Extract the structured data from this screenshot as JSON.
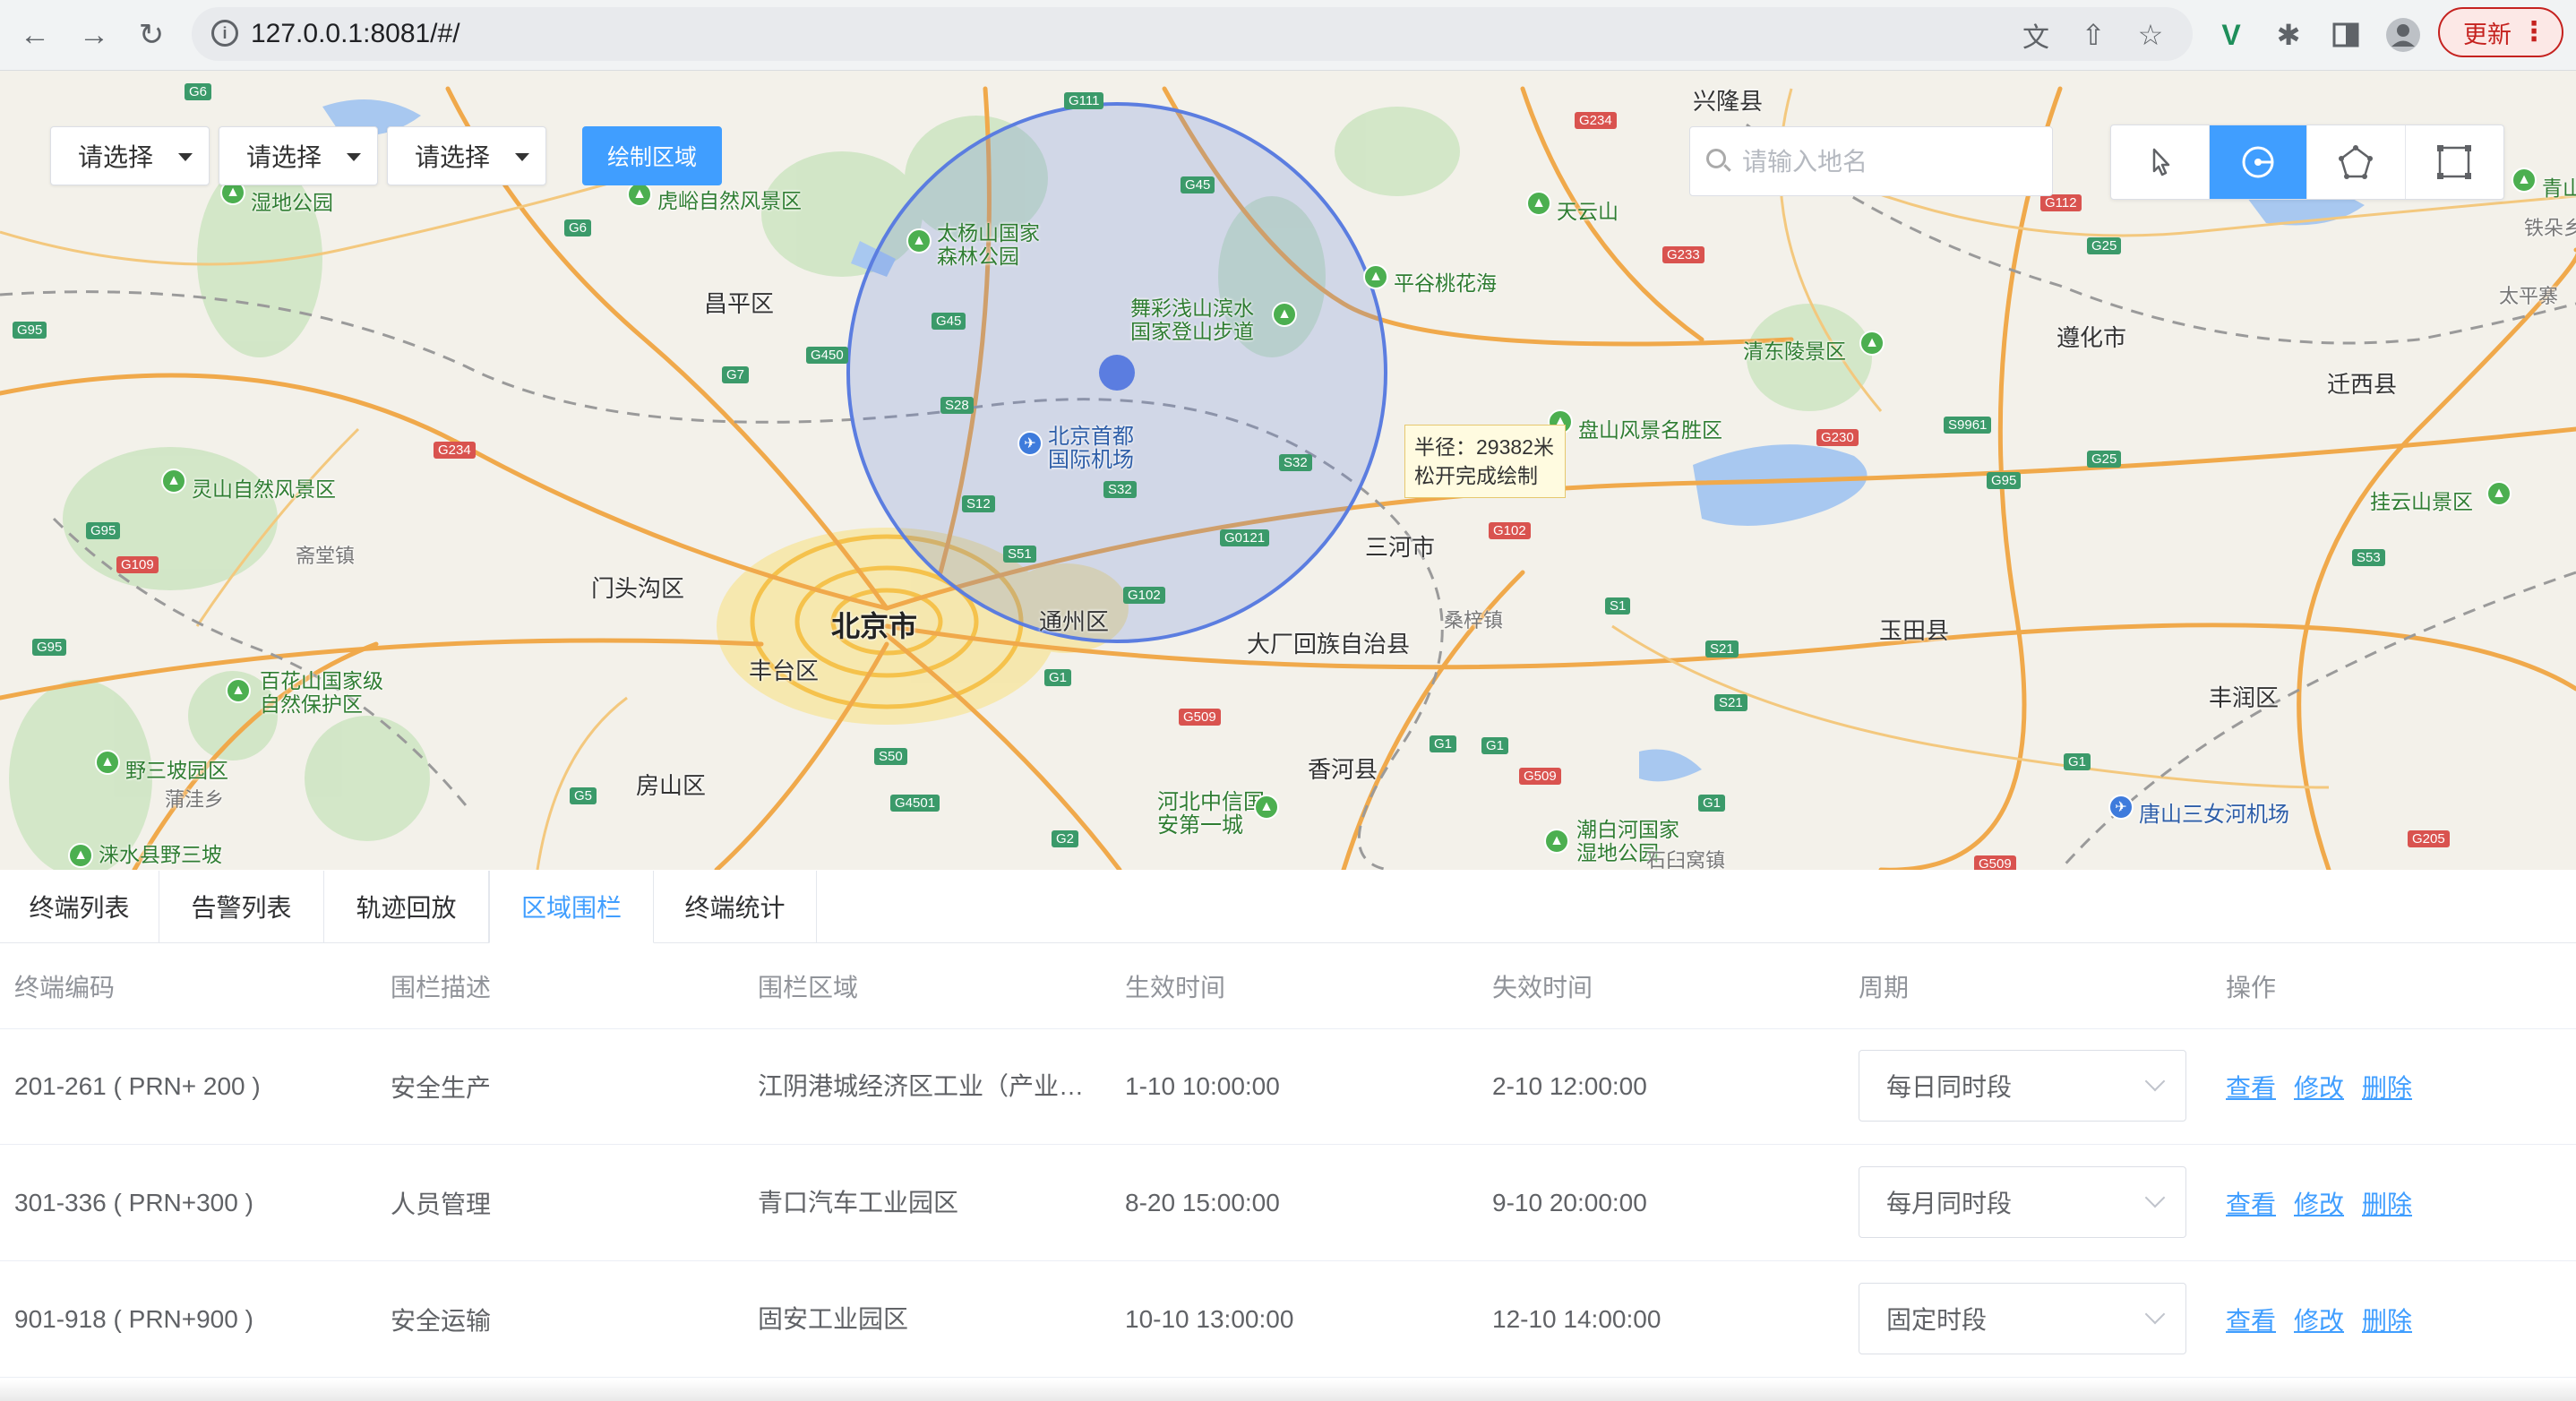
{
  "browser": {
    "url": "127.0.0.1:8081/#/",
    "update_label": "更新"
  },
  "map": {
    "selects": [
      "请选择",
      "请选择",
      "请选择"
    ],
    "draw_button": "绘制区域",
    "search_placeholder": "请输入地名",
    "tools": [
      "pointer-icon",
      "circle-draw-icon",
      "polygon-draw-icon",
      "rectangle-draw-icon"
    ],
    "active_tool": "circle-draw-icon",
    "tooltip": {
      "radius": "半径：29382米",
      "hint": "松开完成绘制"
    },
    "accent_color": "#409eff",
    "circle_color": "#5b7de0",
    "places": {
      "beijing": "北京市",
      "changping": "昌平区",
      "mentougou": "门头沟区",
      "fengtai": "丰台区",
      "fangshan": "房山区",
      "tongzhou": "通州区",
      "sanhe": "三河市",
      "dachang": "大厂回族自治县",
      "xianghe": "香河县",
      "yutian": "玉田县",
      "zunhua": "遵化市",
      "qianxi": "迁西县",
      "xinglong": "兴隆县",
      "fengrun": "丰润区",
      "airport": "北京首都国际机场",
      "taiyang": "太杨山国家森林公园",
      "wucai": "舞彩浅山滨水国家登山步道",
      "pinggu": "平谷桃花海",
      "tianyun": "天云山",
      "qingdongling": "清东陵景区",
      "panshan": "盘山风景名胜区",
      "lingshan": "灵山自然风景区",
      "baihua": "百花山国家级自然保护区",
      "yesanpo": "野三坡园区",
      "hubei_cite": "河北中信国安第一城",
      "chaobai": "潮白河国家湿地公园",
      "tangshan_airport": "唐山三女河机场",
      "guayun": "挂云山景区",
      "huyu": "虎峪自然风景区",
      "shidi": "湿地公园",
      "zhaitang": "斋堂镇",
      "puwa": "蒲洼乡",
      "sangzi": "桑梓镇",
      "shibai": "石臼窝镇",
      "taiping": "太平寨",
      "qing": "青山",
      "zhangxia": "铁朵乡",
      "laishui": "涞水县野三坡"
    }
  },
  "tabs": [
    "终端列表",
    "告警列表",
    "轨迹回放",
    "区域围栏",
    "终端统计"
  ],
  "active_tab": "区域围栏",
  "table": {
    "headers": [
      "终端编码",
      "围栏描述",
      "围栏区域",
      "生效时间",
      "失效时间",
      "周期",
      "操作"
    ],
    "rows": [
      {
        "code": "201-261 ( PRN+ 200 )",
        "desc": "安全生产",
        "area": "江阴港城经济区工业（产业园区）",
        "start": "1-10 10:00:00",
        "end": "2-10 12:00:00",
        "period": "每日同时段"
      },
      {
        "code": "301-336 ( PRN+300 )",
        "desc": "人员管理",
        "area": "青口汽车工业园区",
        "start": "8-20 15:00:00",
        "end": "9-10 20:00:00",
        "period": "每月同时段"
      },
      {
        "code": "901-918 ( PRN+900 )",
        "desc": "安全运输",
        "area": "固安工业园区",
        "start": "10-10 13:00:00",
        "end": "12-10 14:00:00",
        "period": "固定时段"
      }
    ],
    "ops": {
      "view": "查看",
      "edit": "修改",
      "delete": "删除"
    }
  }
}
